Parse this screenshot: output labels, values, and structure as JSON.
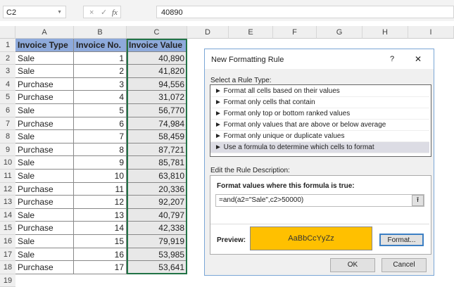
{
  "formula_bar": {
    "name_box": "C2",
    "cancel": "×",
    "enter": "✓",
    "fx": "fx",
    "value": "40890"
  },
  "columns": [
    "A",
    "B",
    "C",
    "D",
    "E",
    "F",
    "G",
    "H",
    "I"
  ],
  "headers": [
    "Invoice Type",
    "Invoice No.",
    "Invoice Value"
  ],
  "rows": [
    [
      "Sale",
      "1",
      "40,890"
    ],
    [
      "Sale",
      "2",
      "41,820"
    ],
    [
      "Purchase",
      "3",
      "94,556"
    ],
    [
      "Purchase",
      "4",
      "31,072"
    ],
    [
      "Sale",
      "5",
      "56,770"
    ],
    [
      "Purchase",
      "6",
      "74,984"
    ],
    [
      "Sale",
      "7",
      "58,459"
    ],
    [
      "Purchase",
      "8",
      "87,721"
    ],
    [
      "Sale",
      "9",
      "85,781"
    ],
    [
      "Sale",
      "10",
      "63,810"
    ],
    [
      "Purchase",
      "11",
      "20,336"
    ],
    [
      "Purchase",
      "12",
      "92,207"
    ],
    [
      "Sale",
      "13",
      "40,797"
    ],
    [
      "Purchase",
      "14",
      "42,338"
    ],
    [
      "Sale",
      "15",
      "79,919"
    ],
    [
      "Sale",
      "16",
      "53,985"
    ],
    [
      "Purchase",
      "17",
      "53,641"
    ]
  ],
  "row_numbers": [
    "1",
    "2",
    "3",
    "4",
    "5",
    "6",
    "7",
    "8",
    "9",
    "10",
    "11",
    "12",
    "13",
    "14",
    "15",
    "16",
    "17",
    "18",
    "19"
  ],
  "dialog": {
    "title": "New Formatting Rule",
    "help": "?",
    "close": "✕",
    "select_label": "Select a Rule Type:",
    "rules": [
      "► Format all cells based on their values",
      "► Format only cells that contain",
      "► Format only top or bottom ranked values",
      "► Format only values that are above or below average",
      "► Format only unique or duplicate values",
      "► Use a formula to determine which cells to format"
    ],
    "edit_label": "Edit the Rule Description:",
    "formula_label": "Format values where this formula is true:",
    "formula": "=and(a2=\"Sale\",c2>50000)",
    "collapse": "⭱",
    "preview_label": "Preview:",
    "preview_text": "AaBbCcYyZz",
    "preview_color": "#ffc000",
    "format_button": "Format...",
    "ok": "OK",
    "cancel": "Cancel"
  }
}
